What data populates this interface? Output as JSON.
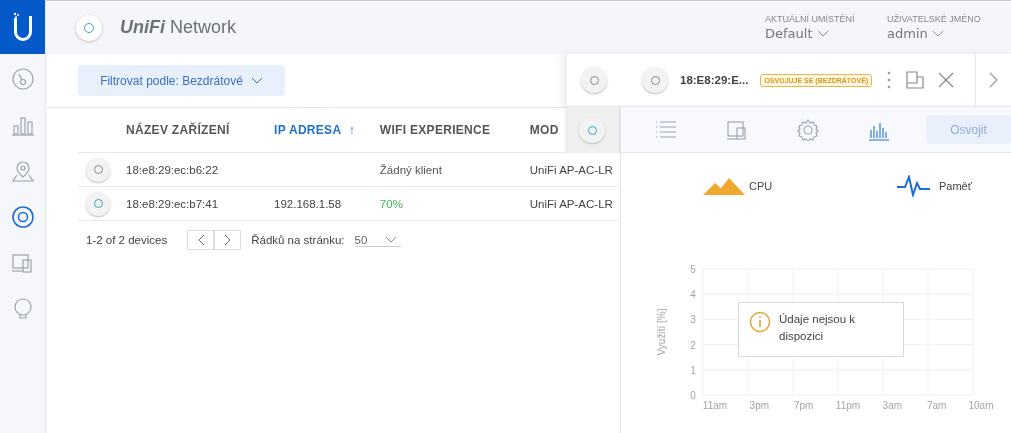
{
  "sidebar": {
    "items": [
      {
        "kind": "gauge",
        "selected": false
      },
      {
        "kind": "bars",
        "selected": false
      },
      {
        "kind": "pin",
        "selected": false
      },
      {
        "kind": "ring",
        "selected": true
      },
      {
        "kind": "devices",
        "selected": false
      },
      {
        "kind": "bulb",
        "selected": false
      }
    ]
  },
  "header": {
    "brand": "UniFi",
    "product": "Network",
    "location_label": "AKTUÁLNÍ UMÍSTĚNÍ",
    "location": "Default",
    "user_label": "UŽIVATELSKÉ JMÉNO",
    "user": "admin"
  },
  "filter": {
    "label": "Filtrovat podle: Bezdrátové"
  },
  "table": {
    "columns": [
      {
        "label": "NÁZEV ZAŘÍZENÍ",
        "sorted": false
      },
      {
        "label": "IP ADRESA",
        "sorted": true,
        "sort_icon": "↑"
      },
      {
        "label": "WIFI EXPERIENCE",
        "sorted": false
      },
      {
        "label": "MOD",
        "sorted": false
      }
    ],
    "rows": [
      {
        "adopted": false,
        "name": "18:e8:29:ec:b6:22",
        "ip": "",
        "wifi": "Žádný klient",
        "model": "UniFi AP-AC-LR"
      },
      {
        "adopted": true,
        "name": "18:e8:29:ec:b7:41",
        "ip": "192.168.1.58",
        "wifi": "70%",
        "model": "UniFi AP-AC-LR"
      }
    ]
  },
  "pagination": {
    "summary": "1-2 of 2 devices",
    "rows_label": "Řádků na stránku:",
    "rows_value": "50"
  },
  "panel": {
    "device_name": "18:E8:29:E...",
    "badge": "OSVOJUJE SE (BEZDRÁTOVÉ)",
    "tabs": [
      {
        "kind": "list",
        "selected": false
      },
      {
        "kind": "devices",
        "selected": false
      },
      {
        "kind": "gear",
        "selected": false
      },
      {
        "kind": "chart",
        "selected": true
      }
    ],
    "adopt_button": "Osvojit",
    "legend": [
      {
        "kind": "area",
        "label": "CPU",
        "color": "#f0a92e"
      },
      {
        "kind": "line",
        "label": "Paměť",
        "color": "#1a6fd6"
      }
    ],
    "chart_data": {
      "type": "line",
      "grid": true,
      "ylabel": "Využití [%]",
      "categories": [
        "11am",
        "3pm",
        "7pm",
        "11pm",
        "3am",
        "7am",
        "10am"
      ],
      "ylim": [
        0,
        5
      ],
      "yticks": [
        0,
        1,
        2,
        3,
        4,
        5
      ]
    },
    "message": "Údaje nejsou k dispozici"
  }
}
